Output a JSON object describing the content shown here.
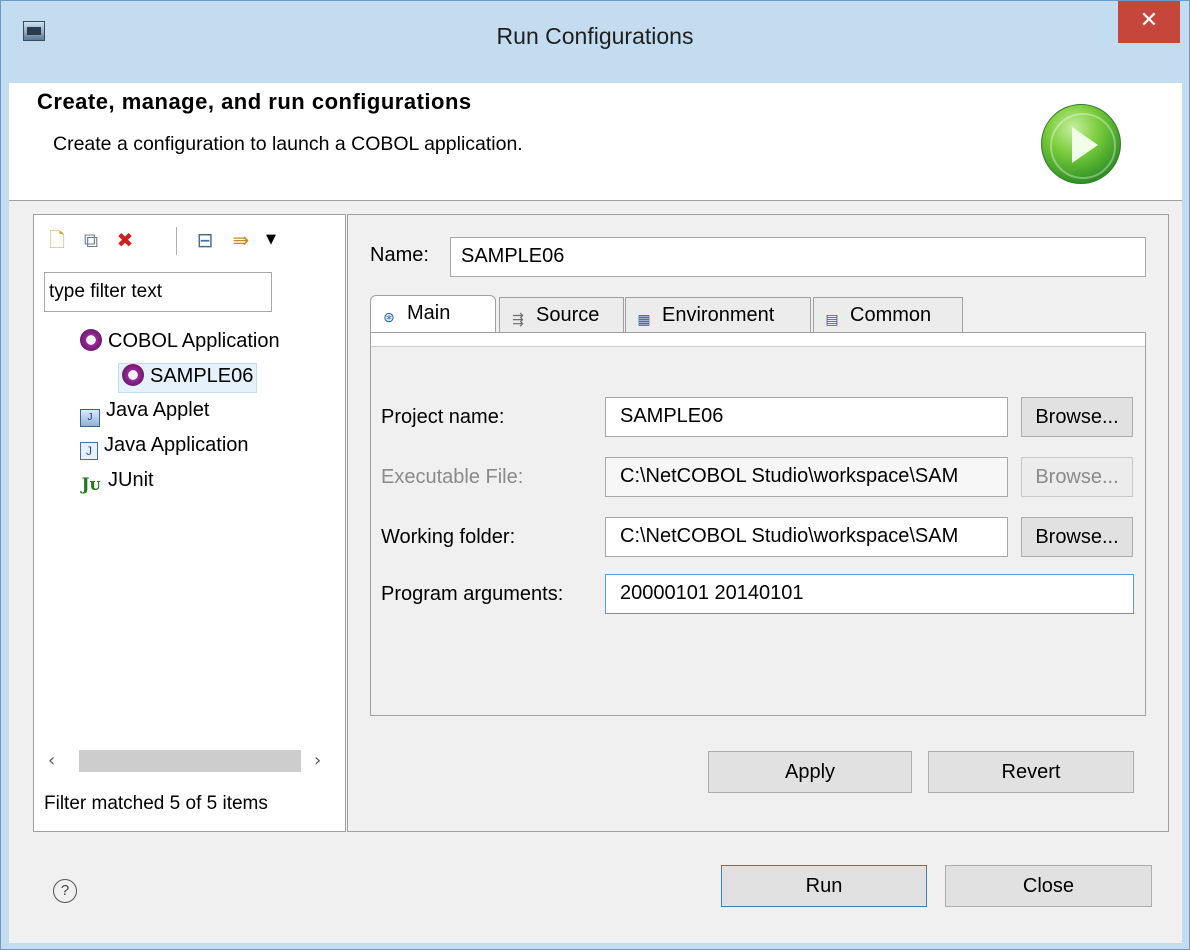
{
  "window": {
    "title": "Run Configurations",
    "close_glyph": "✕"
  },
  "header": {
    "title": "Create, manage, and run configurations",
    "message": "Create a configuration to launch a COBOL application."
  },
  "left": {
    "toolbar_icons": [
      "new-configuration-icon",
      "duplicate-icon",
      "delete-icon",
      "collapse-all-icon",
      "filter-icon",
      "dropdown-arrow-icon"
    ],
    "filter_placeholder": "type filter text",
    "tree": [
      {
        "label": "COBOL Application",
        "icon": "cobol-application-icon"
      },
      {
        "label": "SAMPLE06",
        "icon": "cobol-application-icon",
        "selected": true
      },
      {
        "label": "Java Applet",
        "icon": "java-applet-icon"
      },
      {
        "label": "Java Application",
        "icon": "java-application-icon"
      },
      {
        "label": "JUnit",
        "icon": "junit-icon"
      }
    ],
    "status": "Filter matched 5 of 5 items"
  },
  "right": {
    "name_label": "Name:",
    "name_value": "SAMPLE06",
    "tabs": [
      {
        "label": "Main",
        "active": true
      },
      {
        "label": "Source"
      },
      {
        "label": "Environment"
      },
      {
        "label": "Common"
      }
    ],
    "fields": {
      "project_label": "Project name:",
      "project_value": "SAMPLE06",
      "executable_label": "Executable File:",
      "executable_value": "C:\\NetCOBOL Studio\\workspace\\SAM",
      "working_label": "Working folder:",
      "working_value": "C:\\NetCOBOL Studio\\workspace\\SAM",
      "args_label": "Program arguments:",
      "args_value": "20000101 20140101"
    },
    "browse_label": "Browse...",
    "apply_label": "Apply",
    "revert_label": "Revert"
  },
  "footer": {
    "help_glyph": "?",
    "run_label": "Run",
    "close_label": "Close"
  },
  "colors": {
    "title_bar": "#c4dcf0",
    "close_button": "#c7463b",
    "selection": "#e5f1fb",
    "focus_border": "#5b9bd5",
    "run_badge": "#2f9324"
  }
}
